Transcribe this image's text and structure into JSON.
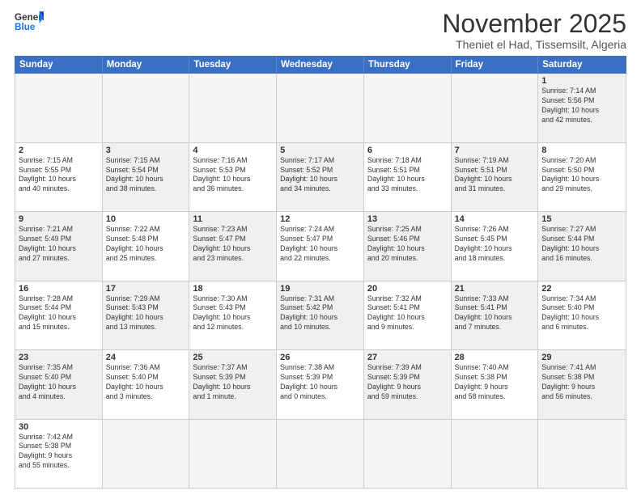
{
  "header": {
    "logo_general": "General",
    "logo_blue": "Blue",
    "month_title": "November 2025",
    "location": "Theniet el Had, Tissemsilt, Algeria"
  },
  "days_of_week": [
    "Sunday",
    "Monday",
    "Tuesday",
    "Wednesday",
    "Thursday",
    "Friday",
    "Saturday"
  ],
  "weeks": [
    [
      {
        "day": "",
        "info": "",
        "empty": true
      },
      {
        "day": "",
        "info": "",
        "empty": true
      },
      {
        "day": "",
        "info": "",
        "empty": true
      },
      {
        "day": "",
        "info": "",
        "empty": true
      },
      {
        "day": "",
        "info": "",
        "empty": true
      },
      {
        "day": "",
        "info": "",
        "empty": true
      },
      {
        "day": "1",
        "info": "Sunrise: 7:14 AM\nSunset: 5:56 PM\nDaylight: 10 hours\nand 42 minutes.",
        "shaded": true
      }
    ],
    [
      {
        "day": "2",
        "info": "Sunrise: 7:15 AM\nSunset: 5:55 PM\nDaylight: 10 hours\nand 40 minutes."
      },
      {
        "day": "3",
        "info": "Sunrise: 7:15 AM\nSunset: 5:54 PM\nDaylight: 10 hours\nand 38 minutes.",
        "shaded": true
      },
      {
        "day": "4",
        "info": "Sunrise: 7:16 AM\nSunset: 5:53 PM\nDaylight: 10 hours\nand 36 minutes."
      },
      {
        "day": "5",
        "info": "Sunrise: 7:17 AM\nSunset: 5:52 PM\nDaylight: 10 hours\nand 34 minutes.",
        "shaded": true
      },
      {
        "day": "6",
        "info": "Sunrise: 7:18 AM\nSunset: 5:51 PM\nDaylight: 10 hours\nand 33 minutes."
      },
      {
        "day": "7",
        "info": "Sunrise: 7:19 AM\nSunset: 5:51 PM\nDaylight: 10 hours\nand 31 minutes.",
        "shaded": true
      },
      {
        "day": "8",
        "info": "Sunrise: 7:20 AM\nSunset: 5:50 PM\nDaylight: 10 hours\nand 29 minutes."
      }
    ],
    [
      {
        "day": "9",
        "info": "Sunrise: 7:21 AM\nSunset: 5:49 PM\nDaylight: 10 hours\nand 27 minutes.",
        "shaded": true
      },
      {
        "day": "10",
        "info": "Sunrise: 7:22 AM\nSunset: 5:48 PM\nDaylight: 10 hours\nand 25 minutes."
      },
      {
        "day": "11",
        "info": "Sunrise: 7:23 AM\nSunset: 5:47 PM\nDaylight: 10 hours\nand 23 minutes.",
        "shaded": true
      },
      {
        "day": "12",
        "info": "Sunrise: 7:24 AM\nSunset: 5:47 PM\nDaylight: 10 hours\nand 22 minutes."
      },
      {
        "day": "13",
        "info": "Sunrise: 7:25 AM\nSunset: 5:46 PM\nDaylight: 10 hours\nand 20 minutes.",
        "shaded": true
      },
      {
        "day": "14",
        "info": "Sunrise: 7:26 AM\nSunset: 5:45 PM\nDaylight: 10 hours\nand 18 minutes."
      },
      {
        "day": "15",
        "info": "Sunrise: 7:27 AM\nSunset: 5:44 PM\nDaylight: 10 hours\nand 16 minutes.",
        "shaded": true
      }
    ],
    [
      {
        "day": "16",
        "info": "Sunrise: 7:28 AM\nSunset: 5:44 PM\nDaylight: 10 hours\nand 15 minutes."
      },
      {
        "day": "17",
        "info": "Sunrise: 7:29 AM\nSunset: 5:43 PM\nDaylight: 10 hours\nand 13 minutes.",
        "shaded": true
      },
      {
        "day": "18",
        "info": "Sunrise: 7:30 AM\nSunset: 5:43 PM\nDaylight: 10 hours\nand 12 minutes."
      },
      {
        "day": "19",
        "info": "Sunrise: 7:31 AM\nSunset: 5:42 PM\nDaylight: 10 hours\nand 10 minutes.",
        "shaded": true
      },
      {
        "day": "20",
        "info": "Sunrise: 7:32 AM\nSunset: 5:41 PM\nDaylight: 10 hours\nand 9 minutes."
      },
      {
        "day": "21",
        "info": "Sunrise: 7:33 AM\nSunset: 5:41 PM\nDaylight: 10 hours\nand 7 minutes.",
        "shaded": true
      },
      {
        "day": "22",
        "info": "Sunrise: 7:34 AM\nSunset: 5:40 PM\nDaylight: 10 hours\nand 6 minutes."
      }
    ],
    [
      {
        "day": "23",
        "info": "Sunrise: 7:35 AM\nSunset: 5:40 PM\nDaylight: 10 hours\nand 4 minutes.",
        "shaded": true
      },
      {
        "day": "24",
        "info": "Sunrise: 7:36 AM\nSunset: 5:40 PM\nDaylight: 10 hours\nand 3 minutes."
      },
      {
        "day": "25",
        "info": "Sunrise: 7:37 AM\nSunset: 5:39 PM\nDaylight: 10 hours\nand 1 minute.",
        "shaded": true
      },
      {
        "day": "26",
        "info": "Sunrise: 7:38 AM\nSunset: 5:39 PM\nDaylight: 10 hours\nand 0 minutes."
      },
      {
        "day": "27",
        "info": "Sunrise: 7:39 AM\nSunset: 5:39 PM\nDaylight: 9 hours\nand 59 minutes.",
        "shaded": true
      },
      {
        "day": "28",
        "info": "Sunrise: 7:40 AM\nSunset: 5:38 PM\nDaylight: 9 hours\nand 58 minutes."
      },
      {
        "day": "29",
        "info": "Sunrise: 7:41 AM\nSunset: 5:38 PM\nDaylight: 9 hours\nand 56 minutes.",
        "shaded": true
      }
    ],
    [
      {
        "day": "30",
        "info": "Sunrise: 7:42 AM\nSunset: 5:38 PM\nDaylight: 9 hours\nand 55 minutes."
      },
      {
        "day": "",
        "info": "",
        "empty": true
      },
      {
        "day": "",
        "info": "",
        "empty": true
      },
      {
        "day": "",
        "info": "",
        "empty": true
      },
      {
        "day": "",
        "info": "",
        "empty": true
      },
      {
        "day": "",
        "info": "",
        "empty": true
      },
      {
        "day": "",
        "info": "",
        "empty": true
      }
    ]
  ]
}
